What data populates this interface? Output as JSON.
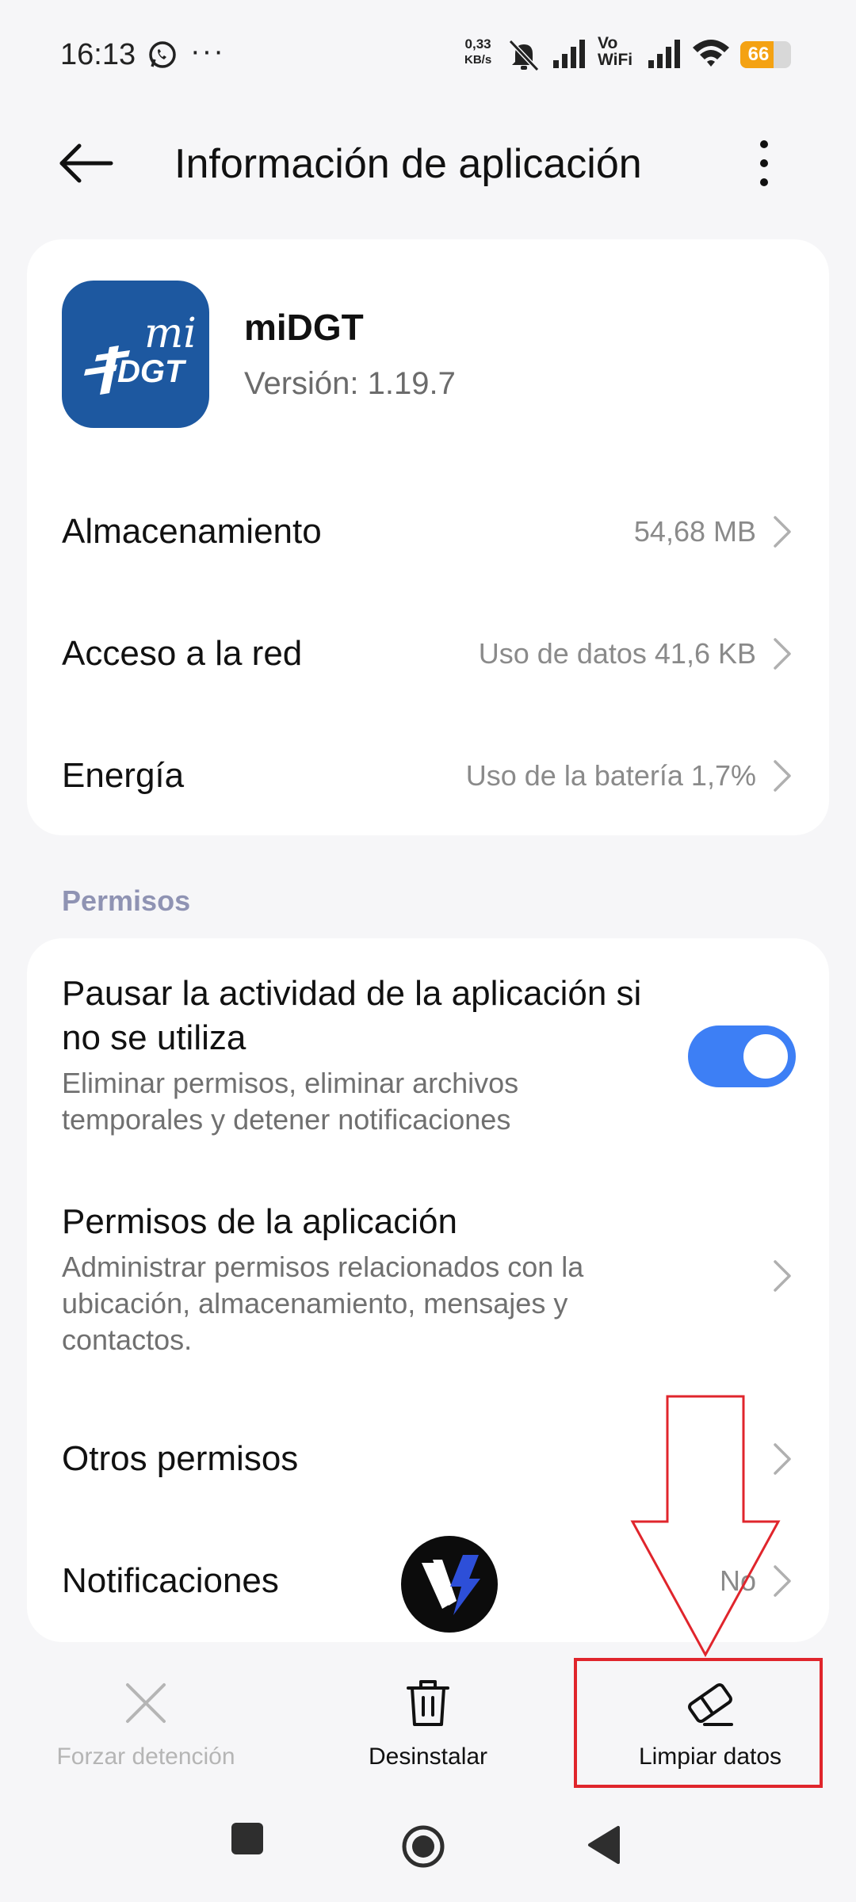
{
  "status_bar": {
    "time": "16:13",
    "network_speed_value": "0,33",
    "network_speed_unit": "KB/s",
    "vowifi_top": "Vo",
    "vowifi_bottom": "WiFi",
    "battery_level": "66",
    "battery_percent": 66,
    "icons": [
      "whatsapp-icon",
      "more-notifications-icon",
      "mute-icon",
      "signal-icon",
      "vowifi-icon",
      "signal-icon",
      "wifi-icon",
      "battery-icon"
    ]
  },
  "header": {
    "title": "Información de aplicación"
  },
  "app": {
    "name": "miDGT",
    "version": "Versión: 1.19.7",
    "icon_text_top": "mi",
    "icon_text_bottom": "DGT",
    "icon_color": "#1d58a0"
  },
  "rows": [
    {
      "title": "Almacenamiento",
      "value": "54,68 MB"
    },
    {
      "title": "Acceso a la red",
      "value": "Uso de datos 41,6 KB"
    },
    {
      "title": "Energía",
      "value": "Uso de la batería 1,7%"
    }
  ],
  "permissions": {
    "section_label": "Permisos",
    "pause": {
      "title": "Pausar la actividad de la aplicación si no se utiliza",
      "subtitle": "Eliminar permisos, eliminar archivos temporales y detener notificaciones",
      "enabled": true
    },
    "app_permissions": {
      "title": "Permisos de la aplicación",
      "subtitle": "Administrar permisos relacionados con la ubicación, almacenamiento, mensajes y contactos."
    },
    "other": {
      "title": "Otros permisos"
    },
    "notifications": {
      "title": "Notificaciones",
      "value": "No"
    }
  },
  "actions": {
    "force_stop": "Forzar detención",
    "uninstall": "Desinstalar",
    "clear_data": "Limpiar datos"
  },
  "colors": {
    "accent": "#3d7ff5",
    "annotation": "#e0252c",
    "section_label": "#8f93b3",
    "battery": "#f4a213"
  }
}
